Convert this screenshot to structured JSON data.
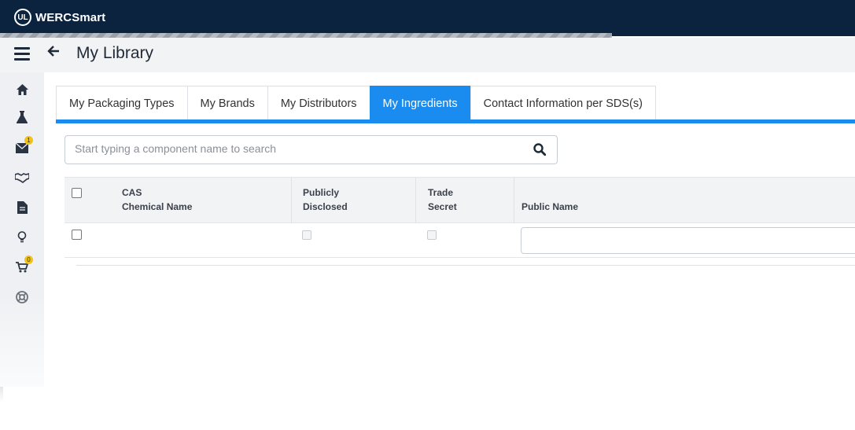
{
  "app": {
    "logo_text": "UL",
    "name": "WERCSmart"
  },
  "header": {
    "title": "My Library"
  },
  "sidebar": {
    "items": [
      {
        "icon": "home-icon"
      },
      {
        "icon": "flask-icon"
      },
      {
        "icon": "mail-icon",
        "badge": "1"
      },
      {
        "icon": "handshake-icon"
      },
      {
        "icon": "document-icon"
      },
      {
        "icon": "lightbulb-icon"
      },
      {
        "icon": "cart-icon",
        "badge": "0"
      },
      {
        "icon": "lifebuoy-icon"
      }
    ]
  },
  "tabs": [
    {
      "label": "My Packaging Types",
      "active": false
    },
    {
      "label": "My Brands",
      "active": false
    },
    {
      "label": "My Distributors",
      "active": false
    },
    {
      "label": "My Ingredients",
      "active": true
    },
    {
      "label": "Contact Information per SDS(s)",
      "active": false
    }
  ],
  "search": {
    "placeholder": "Start typing a component name to search",
    "value": ""
  },
  "table": {
    "columns": {
      "cas_line1": "CAS",
      "cas_line2": "Chemical Name",
      "publicly_line1": "Publicly",
      "publicly_line2": "Disclosed",
      "trade_line1": "Trade",
      "trade_line2": "Secret",
      "public_name": "Public Name"
    },
    "rows": [
      {
        "cas": "",
        "chemical_name": "",
        "publicly_disclosed": false,
        "trade_secret": false,
        "public_name": ""
      }
    ]
  },
  "colors": {
    "topbar": "#0c2340",
    "accent": "#1a8cf0",
    "badge": "#f3c313"
  }
}
